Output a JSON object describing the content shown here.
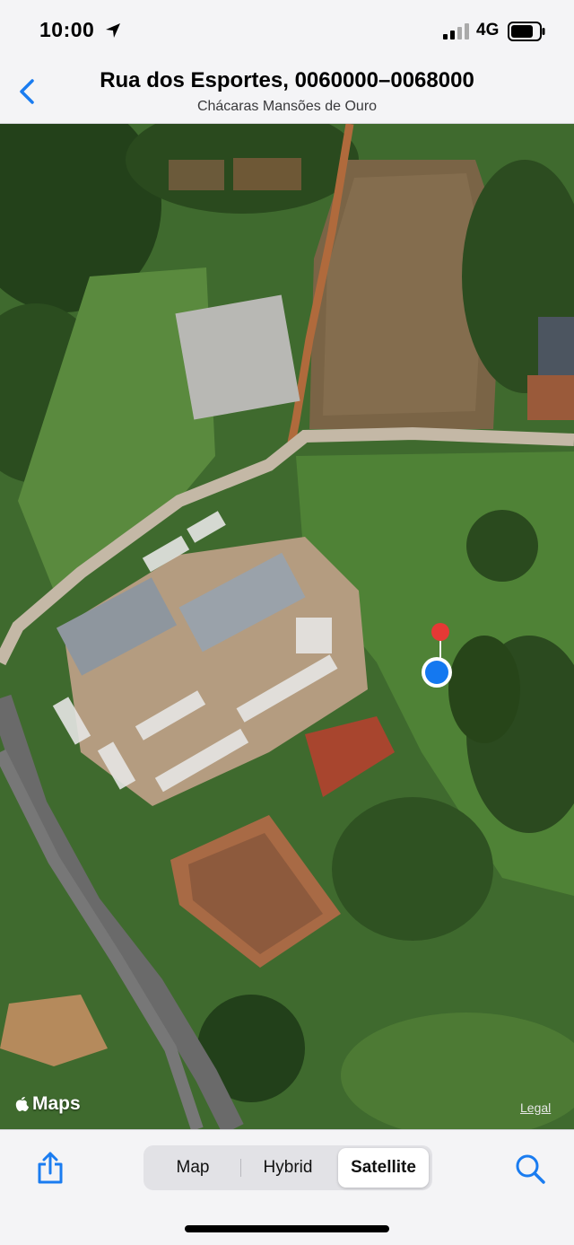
{
  "status_bar": {
    "time": "10:00",
    "network": "4G"
  },
  "header": {
    "title": "Rua dos Esportes, 0060000–0068000",
    "subtitle": "Chácaras Mansões de Ouro"
  },
  "map": {
    "attribution": "Maps",
    "legal": "Legal",
    "pin_color": "#e53935",
    "location_dot_color": "#1478f0"
  },
  "toolbar": {
    "segments": [
      "Map",
      "Hybrid",
      "Satellite"
    ],
    "selected_segment": "Satellite"
  },
  "colors": {
    "accent": "#1a7cf0"
  }
}
